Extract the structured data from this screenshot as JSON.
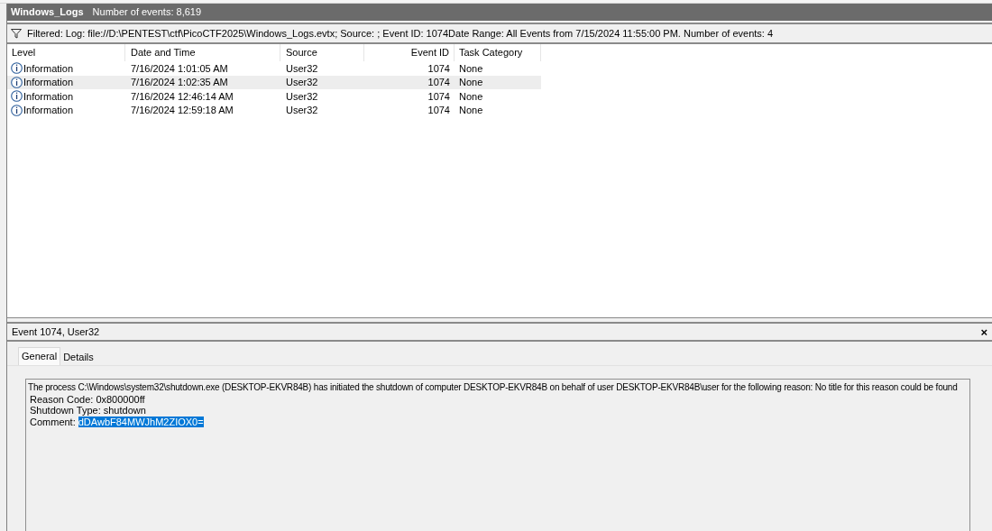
{
  "header": {
    "title": "Windows_Logs",
    "count": "Number of events: 8,619"
  },
  "filter": {
    "text": "Filtered: Log: file://D:\\PENTEST\\ctf\\PicoCTF2025\\Windows_Logs.evtx; Source: ; Event ID: 1074Date Range: All Events from 7/15/2024 11:55:00 PM. Number of events: 4"
  },
  "table": {
    "columns": [
      "Level",
      "Date and Time",
      "Source",
      "Event ID",
      "Task Category"
    ],
    "rows": [
      {
        "level": "Information",
        "date": "7/16/2024 1:01:05 AM",
        "source": "User32",
        "event_id": "1074",
        "task_category": "None",
        "selected": false
      },
      {
        "level": "Information",
        "date": "7/16/2024 1:02:35 AM",
        "source": "User32",
        "event_id": "1074",
        "task_category": "None",
        "selected": true
      },
      {
        "level": "Information",
        "date": "7/16/2024 12:46:14 AM",
        "source": "User32",
        "event_id": "1074",
        "task_category": "None",
        "selected": false
      },
      {
        "level": "Information",
        "date": "7/16/2024 12:59:18 AM",
        "source": "User32",
        "event_id": "1074",
        "task_category": "None",
        "selected": false
      }
    ]
  },
  "detail": {
    "title": "Event 1074, User32",
    "close": "×",
    "tabs": [
      {
        "label": "General",
        "selected": true
      },
      {
        "label": "Details",
        "selected": false
      }
    ],
    "lines": [
      "The process C:\\Windows\\system32\\shutdown.exe (DESKTOP-EKVR84B) has initiated the shutdown of computer DESKTOP-EKVR84B on behalf of user DESKTOP-EKVR84B\\user for the following reason: No title for this reason could be found",
      "Reason Code: 0x800000ff",
      "Shutdown Type: shutdown"
    ],
    "comment": {
      "label": "Comment:",
      "value": "dDAwbF84MWJhM2ZIOX0=",
      "selected": true
    }
  }
}
